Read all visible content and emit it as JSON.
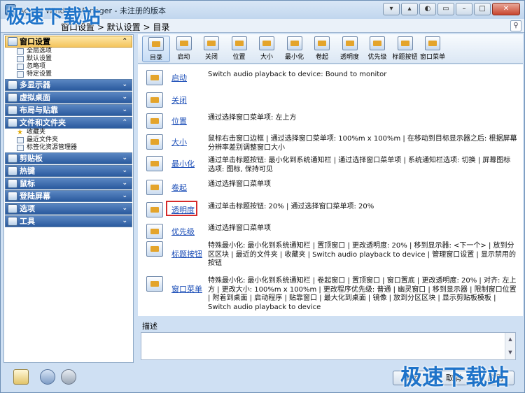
{
  "window": {
    "title": "Actual Window Manager - 未注册的版本"
  },
  "watermark": "极速下载站",
  "breadcrumb": {
    "text": "窗口设置 > 默认设置 > 目录"
  },
  "sidebar": {
    "sections": [
      {
        "label": "窗口设置",
        "icon": "window-settings-icon",
        "items": [
          "全局选项",
          "默认设置",
          "忽略项",
          "特定设置"
        ]
      },
      {
        "label": "多显示器",
        "icon": "monitor-icon",
        "items": []
      },
      {
        "label": "虚拟桌面",
        "icon": "virtual-desktop-icon",
        "items": []
      },
      {
        "label": "布局与贴靠",
        "icon": "layout-icon",
        "items": []
      },
      {
        "label": "文件和文件夹",
        "icon": "folder-icon",
        "items": [
          "收藏夹",
          "最近文件夹",
          "标签化资源管理器"
        ]
      },
      {
        "label": "剪贴板",
        "icon": "clipboard-icon",
        "items": []
      },
      {
        "label": "热键",
        "icon": "hotkey-icon",
        "items": []
      },
      {
        "label": "鼠标",
        "icon": "mouse-icon",
        "items": []
      },
      {
        "label": "登陆屏幕",
        "icon": "logon-icon",
        "items": []
      },
      {
        "label": "选项",
        "icon": "options-icon",
        "items": []
      },
      {
        "label": "工具",
        "icon": "tools-icon",
        "items": []
      }
    ]
  },
  "toolbar": {
    "items": [
      "目录",
      "启动",
      "关闭",
      "位置",
      "大小",
      "最小化",
      "卷起",
      "透明度",
      "优先级",
      "标题按钮",
      "窗口菜单"
    ]
  },
  "rows": [
    {
      "link": "启动",
      "desc": "Switch audio playback to device: Bound to monitor"
    },
    {
      "link": "关闭",
      "desc": ""
    },
    {
      "link": "位置",
      "desc": "通过选择窗口菜单项: 左上方"
    },
    {
      "link": "大小",
      "desc": "鼠标右击窗口边框 | 通过选择窗口菜单项: 100%m x 100%m | 在移动到目标显示器之后: 根据屏幕分辨率差别调整窗口大小"
    },
    {
      "link": "最小化",
      "desc": "通过单击标题按钮: 最小化到系统通知栏 | 通过选择窗口菜单项 | 系统通知栏选项: 切换 | 屏幕图标选项: 图标, 保持可见"
    },
    {
      "link": "卷起",
      "desc": "通过选择窗口菜单项"
    },
    {
      "link": "透明度",
      "desc": "通过单击标题按钮: 20% | 通过选择窗口菜单项: 20%"
    },
    {
      "link": "优先级",
      "desc": "通过选择窗口菜单项"
    },
    {
      "link": "标题按钮",
      "desc": "特殊最小化: 最小化到系统通知栏 | 置顶窗口 | 更改透明度: 20% | 移到显示器: <下一个> | 放到分区区块 | 最近的文件夹 | 收藏夹 | Switch audio playback to device | 管理窗口设置 | 显示禁用的按钮"
    },
    {
      "link": "窗口菜单",
      "desc": "特殊最小化: 最小化到系统通知栏 | 卷起窗口 | 置顶窗口 | 窗口置底 | 更改透明度: 20% | 对齐: 左上方 | 更改大小: 100%m x 100%m | 更改程序优先级: 普通 | 幽灵窗口 | 移到显示器 | 限制窗口位置 | 附着到桌面 | 启动程序 | 贴靠窗口 | 最大化到桌面 | 镜像 | 放到分区区块 | 显示剪贴板模板 | Switch audio playback to device"
    }
  ],
  "description": {
    "label": "描述",
    "text": ""
  },
  "buttons": {
    "ok": "确定",
    "cancel": "取消",
    "apply": "应用"
  },
  "accent": {
    "title_bar": "#c9dbef",
    "sidebar_header": "#3a6aae",
    "active_header": "#f7d57a",
    "link": "#1d4fb8",
    "highlight": "#d62b2b"
  }
}
